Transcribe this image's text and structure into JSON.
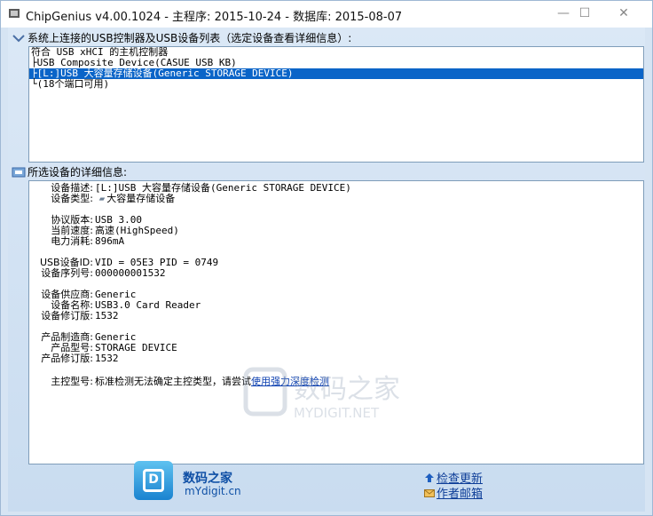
{
  "window": {
    "title": "ChipGenius v4.00.1024 - 主程序: 2015-10-24 - 数据库: 2015-08-07",
    "controls": {
      "minimize": "—",
      "maximize": "☐",
      "close": "✕"
    }
  },
  "device_list": {
    "label": "系统上连接的USB控制器及USB设备列表（选定设备查看详细信息）:",
    "icon": "usb-tree-icon",
    "items": [
      {
        "text": "符合 USB xHCI 的主机控制器",
        "selected": false
      },
      {
        "text": "├USB Composite Device(CASUE USB KB)",
        "selected": false
      },
      {
        "text": "├[L:]USB 大容量存储设备(Generic STORAGE DEVICE)",
        "selected": true
      },
      {
        "text": "└(18个端口可用)",
        "selected": false
      }
    ]
  },
  "details": {
    "label": "所选设备的详细信息:",
    "icon": "device-info-icon",
    "rows": [
      {
        "key": "设备描述:",
        "value": "[L:]USB 大容量存储设备(Generic STORAGE DEVICE)"
      },
      {
        "key": "设备类型:",
        "value": "大容量存储设备",
        "has_icon": true
      },
      {
        "key": "",
        "value": ""
      },
      {
        "key": "协议版本:",
        "value": "USB 3.00"
      },
      {
        "key": "当前速度:",
        "value": "高速(HighSpeed)"
      },
      {
        "key": "电力消耗:",
        "value": "896mA"
      },
      {
        "key": "",
        "value": ""
      },
      {
        "key": "USB设备ID:",
        "value": "VID = 05E3 PID = 0749"
      },
      {
        "key": "设备序列号:",
        "value": "000000001532"
      },
      {
        "key": "",
        "value": ""
      },
      {
        "key": "设备供应商:",
        "value": "Generic"
      },
      {
        "key": "设备名称:",
        "value": "USB3.0 Card Reader"
      },
      {
        "key": "设备修订版:",
        "value": "1532"
      },
      {
        "key": "",
        "value": ""
      },
      {
        "key": "产品制造商:",
        "value": "Generic"
      },
      {
        "key": "产品型号:",
        "value": "STORAGE DEVICE"
      },
      {
        "key": "产品修订版:",
        "value": "1532"
      },
      {
        "key": "",
        "value": ""
      }
    ],
    "controller": {
      "key": "主控型号:",
      "value": "标准检测无法确定主控类型，请尝试",
      "link": "使用强力深度检测"
    }
  },
  "watermark": {
    "line1": "数码之家",
    "line2": "MYDIGIT.NET"
  },
  "footer": {
    "brand": "数码之家",
    "site": "mYdigit.cn",
    "check_update": "检查更新",
    "author_email": "作者邮箱"
  },
  "colors": {
    "selection": "#0a64c8",
    "link": "#0b3fb0",
    "brand_blue": "#1a83d0"
  }
}
